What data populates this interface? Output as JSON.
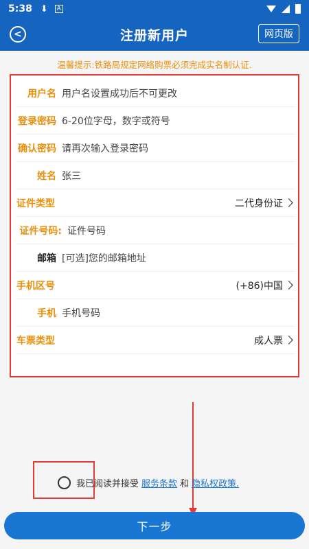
{
  "status_bar": {
    "time": "5:38",
    "download_icon": "download-arrow-icon",
    "a_icon_text": "A"
  },
  "nav": {
    "back_icon": "chevron-left-icon",
    "title": "注册新用户",
    "web_version": "网页版"
  },
  "notice": "温馨提示:铁路局规定网络购票必须完成实名制认证.",
  "form": {
    "rows": [
      {
        "label": "用户名",
        "text": "用户名设置成功后不可更改"
      },
      {
        "label": "登录密码",
        "text": "6-20位字母，数字或符号"
      },
      {
        "label": "确认密码",
        "text": "请再次输入登录密码"
      },
      {
        "label": "姓名",
        "text": "张三"
      },
      {
        "label": "证件类型",
        "text": "二代身份证"
      },
      {
        "label": "证件号码:",
        "text": "证件号码"
      },
      {
        "label": "邮箱",
        "text": "[可选]您的邮箱地址"
      },
      {
        "label": "手机区号",
        "text": "(+86)中国"
      },
      {
        "label": "手机",
        "text": "手机号码"
      },
      {
        "label": "车票类型",
        "text": "成人票"
      }
    ]
  },
  "agreement": {
    "prefix": "我已阅读并接受",
    "terms_link": "服务条款",
    "and": "和",
    "privacy_link": "隐私权政策."
  },
  "next_button": "下一步",
  "colors": {
    "primary": "#1565c0",
    "accent_orange": "#e8900c",
    "annotation_red": "#e53935",
    "button_blue": "#1976d2"
  }
}
